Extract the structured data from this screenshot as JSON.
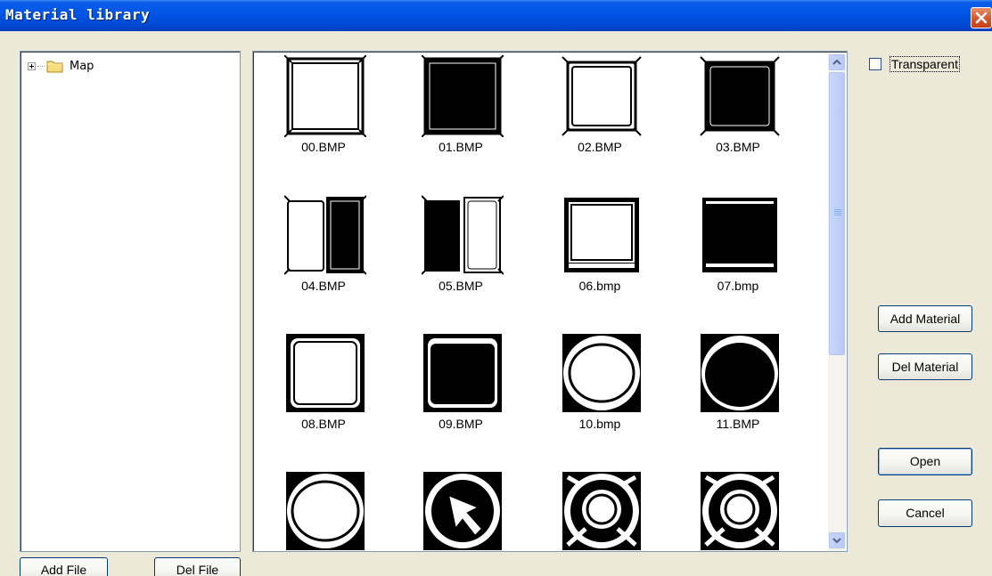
{
  "window": {
    "title": "Material library",
    "close_icon": "close-icon"
  },
  "tree": {
    "items": [
      {
        "label": "Map",
        "icon": "folder-icon",
        "expanded": false
      }
    ]
  },
  "gallery": {
    "items": [
      {
        "label": "00.BMP",
        "icon": "square-frame-white"
      },
      {
        "label": "01.BMP",
        "icon": "square-frame-black"
      },
      {
        "label": "02.BMP",
        "icon": "square-frame-white-rounded"
      },
      {
        "label": "03.BMP",
        "icon": "square-frame-black-rounded"
      },
      {
        "label": "04.BMP",
        "icon": "split-white-black"
      },
      {
        "label": "05.BMP",
        "icon": "split-black-white"
      },
      {
        "label": "06.bmp",
        "icon": "bevel-square-white"
      },
      {
        "label": "07.bmp",
        "icon": "bevel-square-black"
      },
      {
        "label": "08.BMP",
        "icon": "rounded-square-white"
      },
      {
        "label": "09.BMP",
        "icon": "rounded-square-black"
      },
      {
        "label": "10.bmp",
        "icon": "ellipse-white"
      },
      {
        "label": "11.BMP",
        "icon": "ellipse-black"
      },
      {
        "label": "",
        "icon": "ellipse-white-2"
      },
      {
        "label": "",
        "icon": "arrow-cursor"
      },
      {
        "label": "",
        "icon": "magnifier"
      },
      {
        "label": "",
        "icon": "magnifier-2"
      }
    ]
  },
  "scrollbar": {
    "position_fraction": 0.0,
    "visible_fraction": 0.57
  },
  "options": {
    "transparent_label": "Transparent",
    "transparent_checked": false
  },
  "buttons": {
    "add_material": "Add Material",
    "del_material": "Del Material",
    "open": "Open",
    "cancel": "Cancel",
    "add_file": "Add File",
    "del_file": "Del File"
  },
  "colors": {
    "titlebar": "#0055e5",
    "window_bg": "#ece9d8",
    "close": "#d65a2f"
  }
}
